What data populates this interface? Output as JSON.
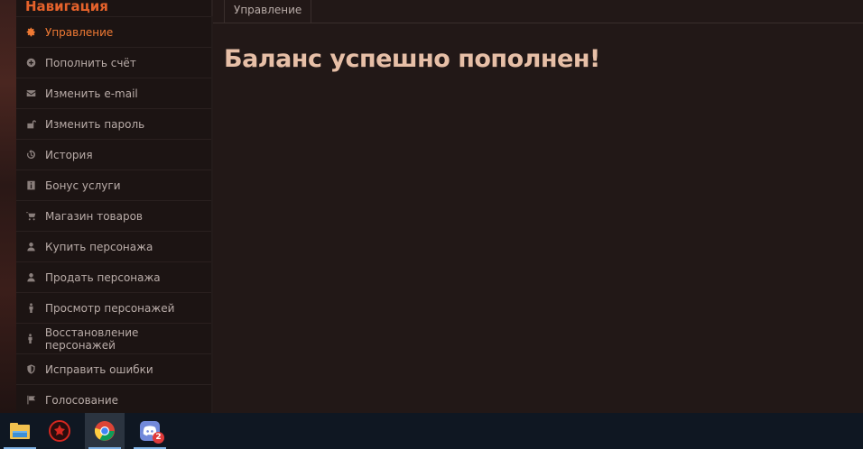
{
  "sidebar": {
    "title": "Навигация",
    "items": [
      {
        "label": "Управление",
        "icon": "gear-icon",
        "active": true
      },
      {
        "label": "Пополнить счёт",
        "icon": "plus-circle-icon"
      },
      {
        "label": "Изменить e-mail",
        "icon": "envelope-icon"
      },
      {
        "label": "Изменить пароль",
        "icon": "unlock-icon"
      },
      {
        "label": "История",
        "icon": "history-icon"
      },
      {
        "label": "Бонус услуги",
        "icon": "info-icon"
      },
      {
        "label": "Магазин товаров",
        "icon": "cart-icon"
      },
      {
        "label": "Купить персонажа",
        "icon": "user-icon"
      },
      {
        "label": "Продать персонажа",
        "icon": "user-icon"
      },
      {
        "label": "Просмотр персонажей",
        "icon": "person-icon"
      },
      {
        "label": "Восстановление персонажей",
        "icon": "person-icon"
      },
      {
        "label": "Исправить ошибки",
        "icon": "shield-icon"
      },
      {
        "label": "Голосование",
        "icon": "flag-icon"
      }
    ]
  },
  "main": {
    "tab": "Управление",
    "heading": "Баланс успешно пополнен!"
  },
  "taskbar": {
    "apps": [
      {
        "name": "file-explorer-icon"
      },
      {
        "name": "game-launcher-icon"
      },
      {
        "name": "chrome-icon",
        "active": true
      },
      {
        "name": "discord-icon",
        "badge": "2"
      }
    ]
  },
  "colors": {
    "accent": "#f07a34",
    "title": "#e5622b",
    "heading": "#e7bfa7",
    "background": "#221817"
  }
}
